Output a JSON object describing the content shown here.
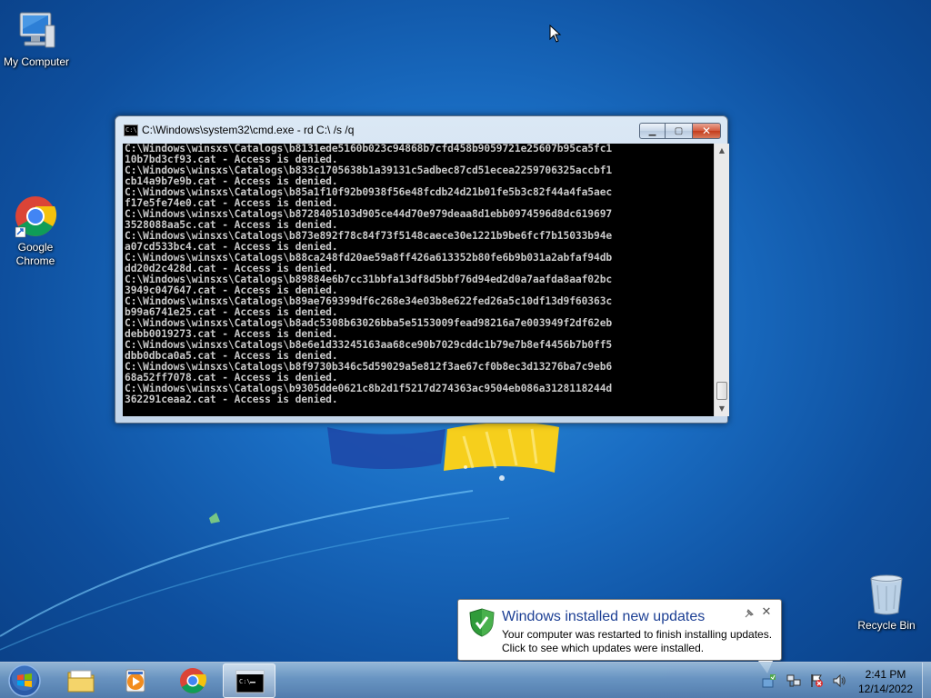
{
  "desktop": {
    "icons": [
      {
        "label": "My Computer",
        "icon": "computer-icon"
      },
      {
        "label": "Google Chrome",
        "icon": "chrome-icon"
      },
      {
        "label": "Recycle Bin",
        "icon": "recycle-bin-icon"
      }
    ]
  },
  "cmd": {
    "title": "C:\\Windows\\system32\\cmd.exe - rd  C:\\ /s /q",
    "icon": "cmd-icon",
    "lines": [
      "C:\\Windows\\winsxs\\Catalogs\\b8131ede5160b023c94868b7cfd458b9059721e25607b95ca5fc1",
      "10b7bd3cf93.cat - Access is denied.",
      "C:\\Windows\\winsxs\\Catalogs\\b833c1705638b1a39131c5adbec87cd51ecea2259706325accbf1",
      "cb14a9b7e9b.cat - Access is denied.",
      "C:\\Windows\\winsxs\\Catalogs\\b85a1f10f92b0938f56e48fcdb24d21b01fe5b3c82f44a4fa5aec",
      "f17e5fe74e0.cat - Access is denied.",
      "C:\\Windows\\winsxs\\Catalogs\\b8728405103d905ce44d70e979deaa8d1ebb0974596d8dc619697",
      "3528088aa5c.cat - Access is denied.",
      "C:\\Windows\\winsxs\\Catalogs\\b873e892f78c84f73f5148caece30e1221b9be6fcf7b15033b94e",
      "a07cd533bc4.cat - Access is denied.",
      "C:\\Windows\\winsxs\\Catalogs\\b88ca248fd20ae59a8ff426a613352b80fe6b9b031a2abfaf94db",
      "dd20d2c428d.cat - Access is denied.",
      "C:\\Windows\\winsxs\\Catalogs\\b89884e6b7cc31bbfa13df8d5bbf76d94ed2d0a7aafda8aaf02bc",
      "3949c047647.cat - Access is denied.",
      "C:\\Windows\\winsxs\\Catalogs\\b89ae769399df6c268e34e03b8e622fed26a5c10df13d9f60363c",
      "b99a6741e25.cat - Access is denied.",
      "C:\\Windows\\winsxs\\Catalogs\\b8adc5308b63026bba5e5153009fead98216a7e003949f2df62eb",
      "debb0019273.cat - Access is denied.",
      "C:\\Windows\\winsxs\\Catalogs\\b8e6e1d33245163aa68ce90b7029cddc1b79e7b8ef4456b7b0ff5",
      "dbb0dbca0a5.cat - Access is denied.",
      "C:\\Windows\\winsxs\\Catalogs\\b8f9730b346c5d59029a5e812f3ae67cf0b8ec3d13276ba7c9eb6",
      "68a52ff7078.cat - Access is denied.",
      "C:\\Windows\\winsxs\\Catalogs\\b9305dde0621c8b2d1f5217d274363ac9504eb086a3128118244d",
      "362291ceaa2.cat - Access is denied."
    ]
  },
  "notification": {
    "title": "Windows installed new updates",
    "line1": "Your computer was restarted to finish installing updates.",
    "line2": "Click to see which updates were installed.",
    "icon": "shield-check-icon"
  },
  "taskbar": {
    "pinned": [
      {
        "name": "explorer",
        "icon": "folder-icon"
      },
      {
        "name": "media-player",
        "icon": "media-player-icon"
      },
      {
        "name": "chrome",
        "icon": "chrome-icon"
      },
      {
        "name": "cmd",
        "icon": "cmd-icon",
        "active": true
      }
    ],
    "tray": [
      {
        "icon": "windows-update-icon"
      },
      {
        "icon": "network-icon"
      },
      {
        "icon": "action-center-flag-icon"
      },
      {
        "icon": "volume-icon"
      }
    ],
    "time": "2:41 PM",
    "date": "12/14/2022"
  },
  "colors": {
    "desktop_blue": "#1a6ec4",
    "console_bg": "#000000",
    "console_text": "#c8c8c8",
    "balloon_title": "#1c3f94"
  }
}
